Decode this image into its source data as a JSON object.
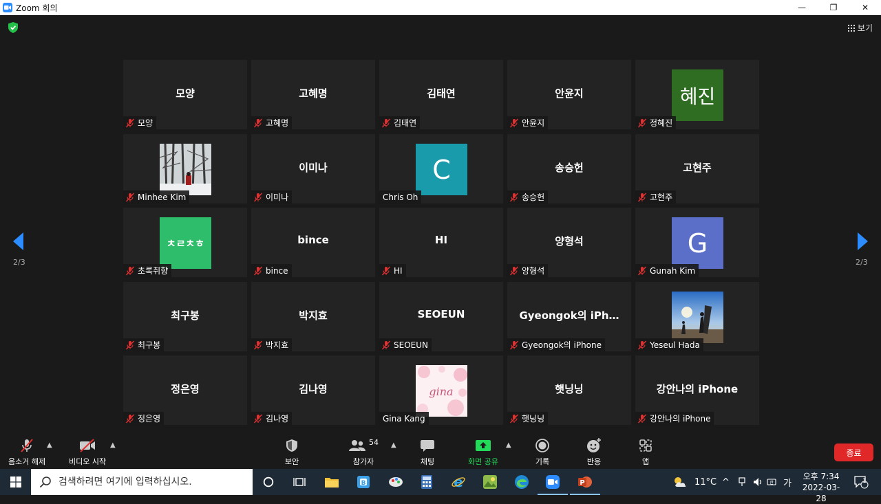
{
  "window": {
    "title": "Zoom 회의",
    "minimize_glyph": "—",
    "restore_glyph": "❐",
    "close_glyph": "✕"
  },
  "topbar": {
    "view_label": "보기"
  },
  "gallery": {
    "page_label": "2/3",
    "tiles": [
      {
        "name": "모양",
        "label": "모양",
        "mic_muted": true
      },
      {
        "name": "고혜명",
        "label": "고혜명",
        "mic_muted": true
      },
      {
        "name": "김태연",
        "label": "김태연",
        "mic_muted": true
      },
      {
        "name": "안윤지",
        "label": "안윤지",
        "mic_muted": true
      },
      {
        "avatar_text": "혜진",
        "avatar_color": "#2f6e22",
        "label": "정혜진",
        "mic_muted": true
      },
      {
        "photo": "snow-forest-photo",
        "label": "Minhee Kim",
        "mic_muted": true
      },
      {
        "name": "이미나",
        "label": "이미나",
        "mic_muted": true
      },
      {
        "avatar_text": "C",
        "avatar_color": "#1a9bab",
        "label": "Chris Oh",
        "mic_muted": false
      },
      {
        "name": "송승헌",
        "label": "송승헌",
        "mic_muted": true
      },
      {
        "name": "고현주",
        "label": "고현주",
        "mic_muted": true
      },
      {
        "avatar_text": "ㅊㄹㅊㅎ",
        "avatar_color": "#2ebd6b",
        "label": "초록취향",
        "mic_muted": true
      },
      {
        "name": "bince",
        "label": "bince",
        "mic_muted": true
      },
      {
        "name": "HI",
        "label": "HI",
        "mic_muted": true
      },
      {
        "name": "양형석",
        "label": "양형석",
        "mic_muted": true
      },
      {
        "avatar_text": "G",
        "avatar_color": "#5b6fc9",
        "label": "Gunah Kim",
        "mic_muted": true
      },
      {
        "name": "최구봉",
        "label": "최구봉",
        "mic_muted": true
      },
      {
        "name": "박지효",
        "label": "박지효",
        "mic_muted": true
      },
      {
        "name": "SEOEUN",
        "label": "SEOEUN",
        "mic_muted": true
      },
      {
        "name": "Gyeongok의 iPh…",
        "label": "Gyeongok의 iPhone",
        "mic_muted": true
      },
      {
        "photo": "surfer-beach-photo",
        "label": "Yeseul Hada",
        "mic_muted": true
      },
      {
        "name": "정은영",
        "label": "정은영",
        "mic_muted": true
      },
      {
        "name": "김나영",
        "label": "김나영",
        "mic_muted": true
      },
      {
        "photo": "gina-pink-photo",
        "photo_text": "gina",
        "label": "Gina Kang",
        "mic_muted": false
      },
      {
        "name": "햇닝닝",
        "label": "햇닝닝",
        "mic_muted": true
      },
      {
        "name": "강안나의 iPhone",
        "label": "강안나의 iPhone",
        "mic_muted": true
      }
    ]
  },
  "toolbar": {
    "unmute_label": "음소거 해제",
    "video_label": "비디오 시작",
    "security_label": "보안",
    "participants_label": "참가자",
    "participants_count": "54",
    "chat_label": "채팅",
    "share_label": "화면 공유",
    "record_label": "기록",
    "reactions_label": "반응",
    "apps_label": "앱",
    "end_label": "종료",
    "share_color": "#23d959",
    "end_color": "#e02828"
  },
  "taskbar": {
    "search_placeholder": "검색하려면 여기에 입력하십시오.",
    "weather_temp": "11°C",
    "ime_label": "가",
    "time": "오후 7:34",
    "date": "2022-03-28",
    "notification_count": "1"
  }
}
